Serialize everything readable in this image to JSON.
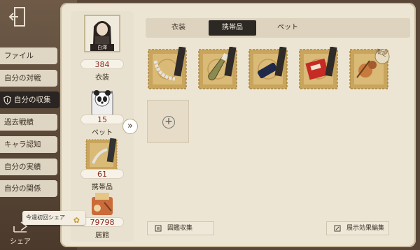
{
  "sidebar": {
    "items": [
      {
        "label": "ファイル"
      },
      {
        "label": "自分の対戦"
      },
      {
        "label": "自分の収集"
      },
      {
        "label": "過去戦績"
      },
      {
        "label": "キャラ認知"
      },
      {
        "label": "自分の実績"
      },
      {
        "label": "自分の関係"
      }
    ],
    "share_label": "シェア",
    "share_tip": "今週初回シェア"
  },
  "stats": {
    "character_name": "白澤",
    "costume_count": "384",
    "costume_label": "衣装",
    "pet_count": "15",
    "pet_label": "ペット",
    "accessory_count": "61",
    "accessory_label": "携帯品",
    "hall_count": "79798",
    "hall_label": "居館"
  },
  "tabs": [
    {
      "label": "衣装"
    },
    {
      "label": "携帯品"
    },
    {
      "label": "ペット"
    }
  ],
  "items": [
    {
      "name": "chain-item",
      "badge": ""
    },
    {
      "name": "champagne-item",
      "badge": ""
    },
    {
      "name": "phone-item",
      "badge": ""
    },
    {
      "name": "book-item",
      "badge": ""
    },
    {
      "name": "toy-item",
      "badge": "限定"
    }
  ],
  "footer": {
    "left_button": "図鑑収集",
    "right_button": "展示効果編集"
  },
  "colors": {
    "active_dark": "#2c2824",
    "count_red": "#8a2b24",
    "panel_bg": "#ede5d4",
    "stamp_gold": "#c8a45c"
  }
}
